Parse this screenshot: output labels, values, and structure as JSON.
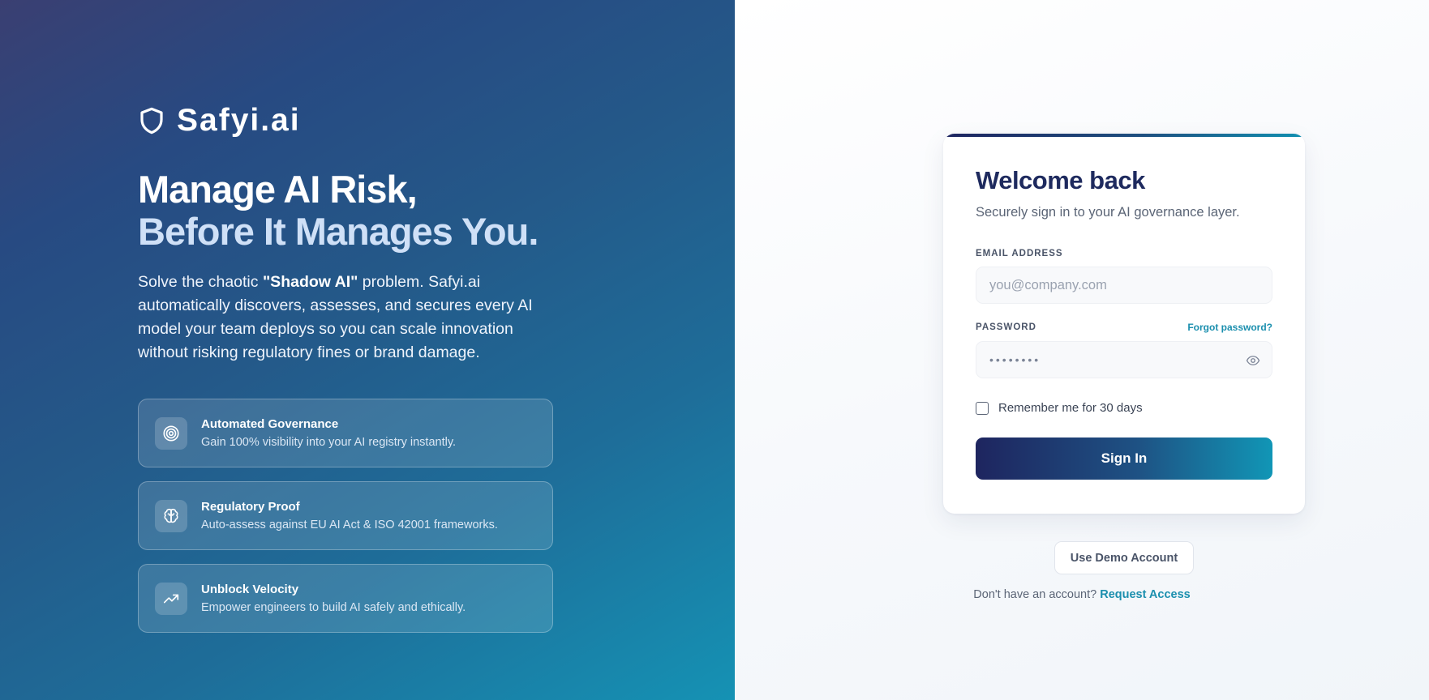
{
  "brand": {
    "logo_icon": "shield-icon",
    "name": "Safyi.ai"
  },
  "hero": {
    "headline_line1": "Manage AI Risk,",
    "headline_line2": "Before It Manages You.",
    "intro_before": "Solve the chaotic ",
    "intro_bold": "\"Shadow AI\"",
    "intro_after": " problem. Safyi.ai automatically discovers, assesses, and secures every AI model your team deploys so you can scale innovation without risking regulatory fines or brand damage."
  },
  "features": [
    {
      "icon": "target-icon",
      "title": "Automated Governance",
      "desc": "Gain 100% visibility into your AI registry instantly."
    },
    {
      "icon": "brain-icon",
      "title": "Regulatory Proof",
      "desc": "Auto-assess against EU AI Act & ISO 42001 frameworks."
    },
    {
      "icon": "trending-up-icon",
      "title": "Unblock Velocity",
      "desc": "Empower engineers to build AI safely and ethically."
    }
  ],
  "login": {
    "title": "Welcome back",
    "subtitle": "Securely sign in to your AI governance layer.",
    "email_label": "EMAIL ADDRESS",
    "email_placeholder": "you@company.com",
    "password_label": "PASSWORD",
    "forgot_link": "Forgot password?",
    "password_value": "••••••••",
    "remember_label": "Remember me for 30 days",
    "remember_checked": false,
    "signin_label": "Sign In"
  },
  "demo_button": "Use Demo Account",
  "signup": {
    "prompt": "Don't have an account? ",
    "link": "Request Access"
  },
  "colors": {
    "accent": "#1b8fae",
    "title": "#1e2a5e",
    "left_gradient_start": "#3a3f72",
    "left_gradient_end": "#1592b4"
  }
}
